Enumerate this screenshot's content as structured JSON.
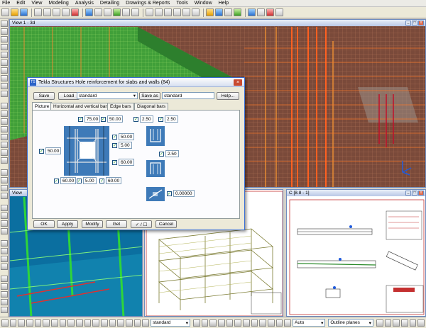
{
  "menu": [
    "File",
    "Edit",
    "View",
    "Modeling",
    "Analysis",
    "Detailing",
    "Drawings & Reports",
    "Tools",
    "Window",
    "Help"
  ],
  "views": {
    "main_title": "View 1 - 3d",
    "left_title": "View",
    "drawing_title": "C  [8.8 - 1]"
  },
  "dialog": {
    "title": "Tekla Structures  Hole reinforcement for slabs and walls (84)",
    "app_icon": "TS",
    "save_label": "Save",
    "load_label": "Load",
    "preset_value": "standard",
    "save_as_label": "Save as",
    "save_as_value": "standard",
    "help_label": "Help...",
    "tabs": [
      "Picture",
      "Horizontal and vertical bars",
      "Edge bars",
      "Diagonal bars"
    ],
    "values": {
      "top_left": "75.00",
      "top_right": "50.00",
      "right_1": "50.00",
      "right_2": "5.00",
      "right_3": "60.00",
      "left_mid": "50.00",
      "bot_1": "60.00",
      "bot_2": "5.00",
      "bot_3": "60.00",
      "edge_a": "2.50",
      "edge_b": "2.50",
      "edge_c": "2.50",
      "diag": "0.00000"
    },
    "ok_label": "OK",
    "apply_label": "Apply",
    "modify_label": "Modify",
    "get_label": "Get",
    "toggle_label": "✓ / ☐",
    "cancel_label": "Cancel"
  },
  "status": {
    "select_standard": "standard",
    "select_auto": "Auto",
    "select_outline": "Outline planes"
  },
  "colors": {
    "rebar": "#ff7a2a",
    "slab": "#3aa83a",
    "grid_bg": "#7a4a3a",
    "dialog_accent": "#3a6fd4",
    "check": "#219c21"
  }
}
